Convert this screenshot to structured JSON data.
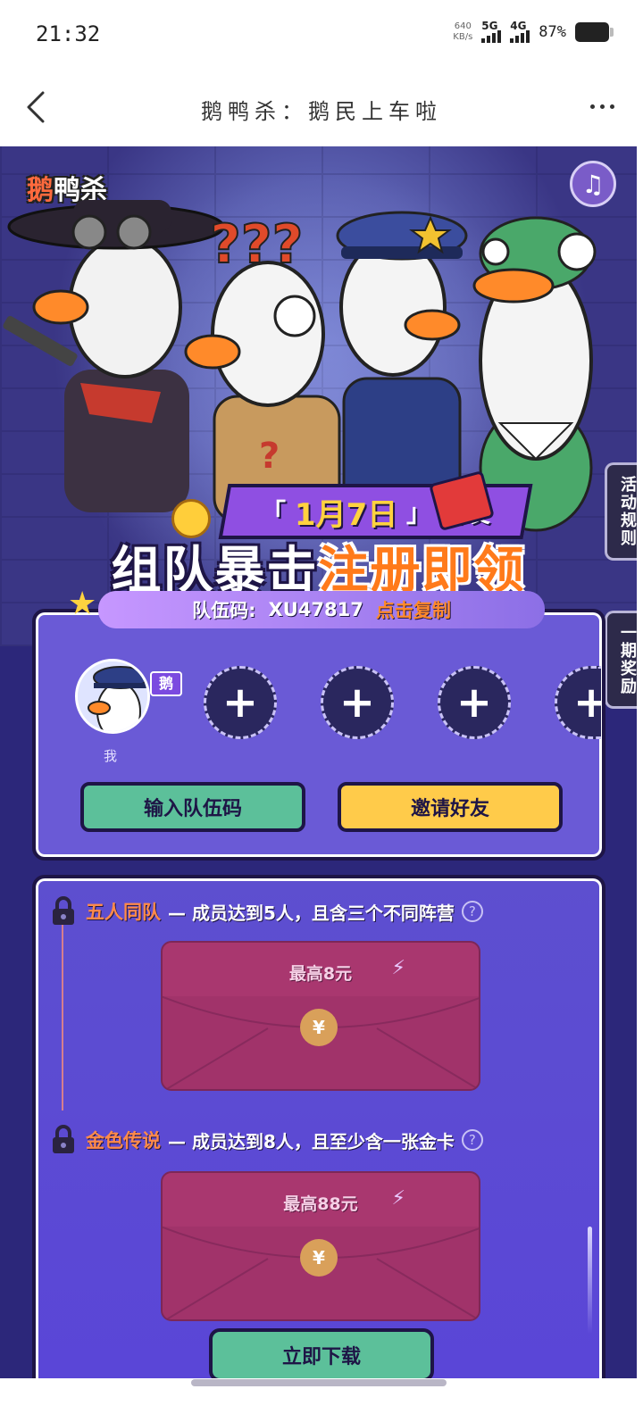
{
  "status_bar": {
    "time": "21:32",
    "net_speed_value": "640",
    "net_speed_unit": "KB/s",
    "signal_1": "5G",
    "signal_2": "4G",
    "battery": "87%"
  },
  "nav": {
    "title": "鹅鸭杀：鹅民上车啦"
  },
  "hero": {
    "logo_a": "鹅",
    "logo_b": "鸭杀",
    "date_open": "「",
    "date": "1月7日",
    "date_close": "」",
    "date_suffix": "首发",
    "headline_white": "组队暴击",
    "headline_orange": "注册即领",
    "team_code_label": "队伍码:",
    "team_code": "XU47817",
    "copy_label": "点击复制"
  },
  "side_tabs": {
    "rules": "活动规则",
    "period_reward": "一期奖励"
  },
  "team": {
    "me_badge": "鹅",
    "me_name": "我",
    "empty_slot_symbol": "+",
    "enter_code_button": "输入队伍码",
    "invite_button": "邀请好友"
  },
  "rewards": [
    {
      "name": "五人同队",
      "desc": "— 成员达到5人，且含三个不同阵营",
      "amount": "最高8元",
      "help": "?"
    },
    {
      "name": "金色传说",
      "desc": "— 成员达到8人，且至少含一张金卡",
      "amount": "最高88元",
      "help": "?"
    }
  ],
  "envelope_seal": "¥",
  "download_button": "立即下载",
  "colors": {
    "bg_deep": "#2c277a",
    "panel_purple": "#6a5ad6",
    "green_button": "#5cc09a",
    "yellow_button": "#ffcb4a",
    "envelope": "#a9376f",
    "accent_orange": "#ff7a1a"
  }
}
